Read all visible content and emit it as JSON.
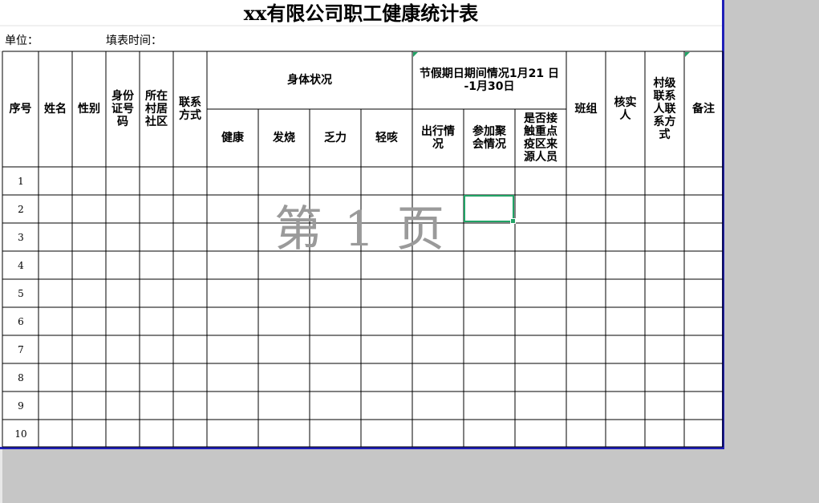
{
  "sheet": {
    "title": "xx有限公司职工健康统计表",
    "unit_label": "单位：",
    "fill_time_label": "填表时间：",
    "watermark": "第 1 页",
    "headers": {
      "seq": "序号",
      "name": "姓名",
      "gender": "性别",
      "id_number": "身份\n证号\n码",
      "community": "所在\n村居\n社区",
      "contact": "联系\n方式",
      "health_group": "身体状况",
      "healthy": "健康",
      "fever": "发烧",
      "fatigue": "乏力",
      "cough": "轻咳",
      "holiday_group": "节假期日期间情况1月21 日\n-1月30日",
      "travel": "出行情\n况",
      "gathering": "参加聚\n会情况",
      "contact_epidemic": "是否接\n触重点\n疫区来\n源人员",
      "team": "班组",
      "verifier": "核实\n人",
      "village_contact": "村级\n联系\n人联\n系方\n式",
      "remarks": "备注"
    },
    "row_numbers": [
      "1",
      "2",
      "3",
      "4",
      "5",
      "6",
      "7",
      "8",
      "9",
      "10"
    ],
    "selected_cell_color": "#21a366",
    "border_color": "#1f1fb8"
  }
}
